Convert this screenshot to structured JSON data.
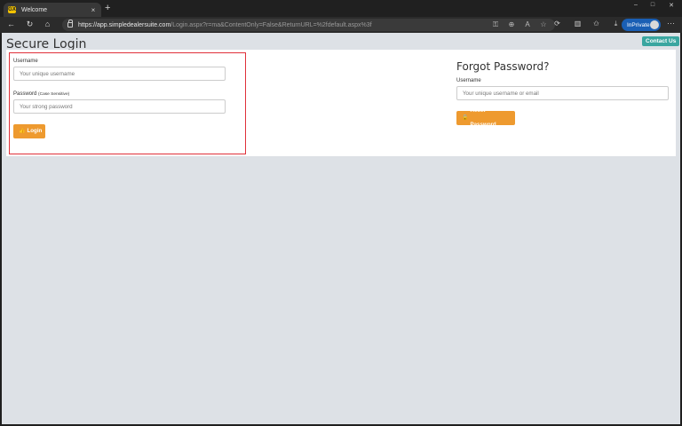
{
  "browser": {
    "tab_title": "Welcome",
    "favicon_text": "GX",
    "new_tab": "+",
    "tab_close": "×",
    "url_host": "https://app.simpledealersuite.com",
    "url_rest": "/Login.aspx?r=ma&ContentOnly=False&ReturnURL=%2fdefault.aspx%3f",
    "inprivate_label": "InPrivate",
    "window_controls": [
      "–",
      "□",
      "✕"
    ],
    "more_label": "···"
  },
  "page": {
    "title": "Secure Login",
    "contact_label": "Contact Us"
  },
  "login": {
    "username_label": "Username",
    "username_placeholder": "Your unique username",
    "password_label": "Password",
    "password_hint": "(Case Sensitive)",
    "password_placeholder": "Your strong password",
    "login_button": "Login"
  },
  "forgot": {
    "title": "Forgot Password?",
    "username_label": "Username",
    "username_placeholder": "Your unique username or email",
    "reset_button": "Reset Password"
  },
  "colors": {
    "accent_orange": "#ee9a2f",
    "contact_teal": "#3aa6a0",
    "highlight_red": "#e0303a",
    "inprivate_blue": "#1a5fb4"
  }
}
